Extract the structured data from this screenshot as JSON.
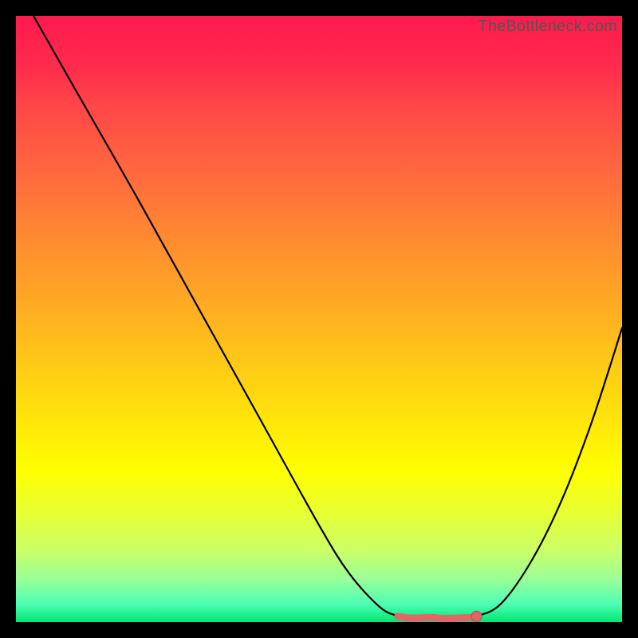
{
  "watermark": "TheBottleneck.com",
  "colors": {
    "frame": "#000000",
    "curve": "#000000",
    "marker_fill": "#e36666",
    "marker_stroke": "#c04e4e",
    "watermark_text": "#555555"
  },
  "chart_data": {
    "type": "line",
    "title": "",
    "xlabel": "",
    "ylabel": "",
    "xlim": [
      0,
      100
    ],
    "ylim": [
      0,
      100
    ],
    "x": [
      2.9,
      10,
      20,
      30,
      40,
      50,
      55,
      60,
      63,
      65,
      67,
      70,
      73,
      76,
      80,
      85,
      90,
      95,
      100
    ],
    "y": [
      100,
      87.5,
      70,
      52,
      34,
      16,
      8,
      2.5,
      1,
      0.7,
      0.7,
      0.7,
      0.7,
      1,
      3,
      10,
      20,
      33,
      48.5
    ],
    "flat_segment": {
      "x_start": 63,
      "x_end": 76,
      "y": 0.8,
      "note": "thick salmon segment with endpoint dot"
    },
    "note": "y is bottleneck percent (lower is better); color gradient red→green encodes same axis"
  }
}
